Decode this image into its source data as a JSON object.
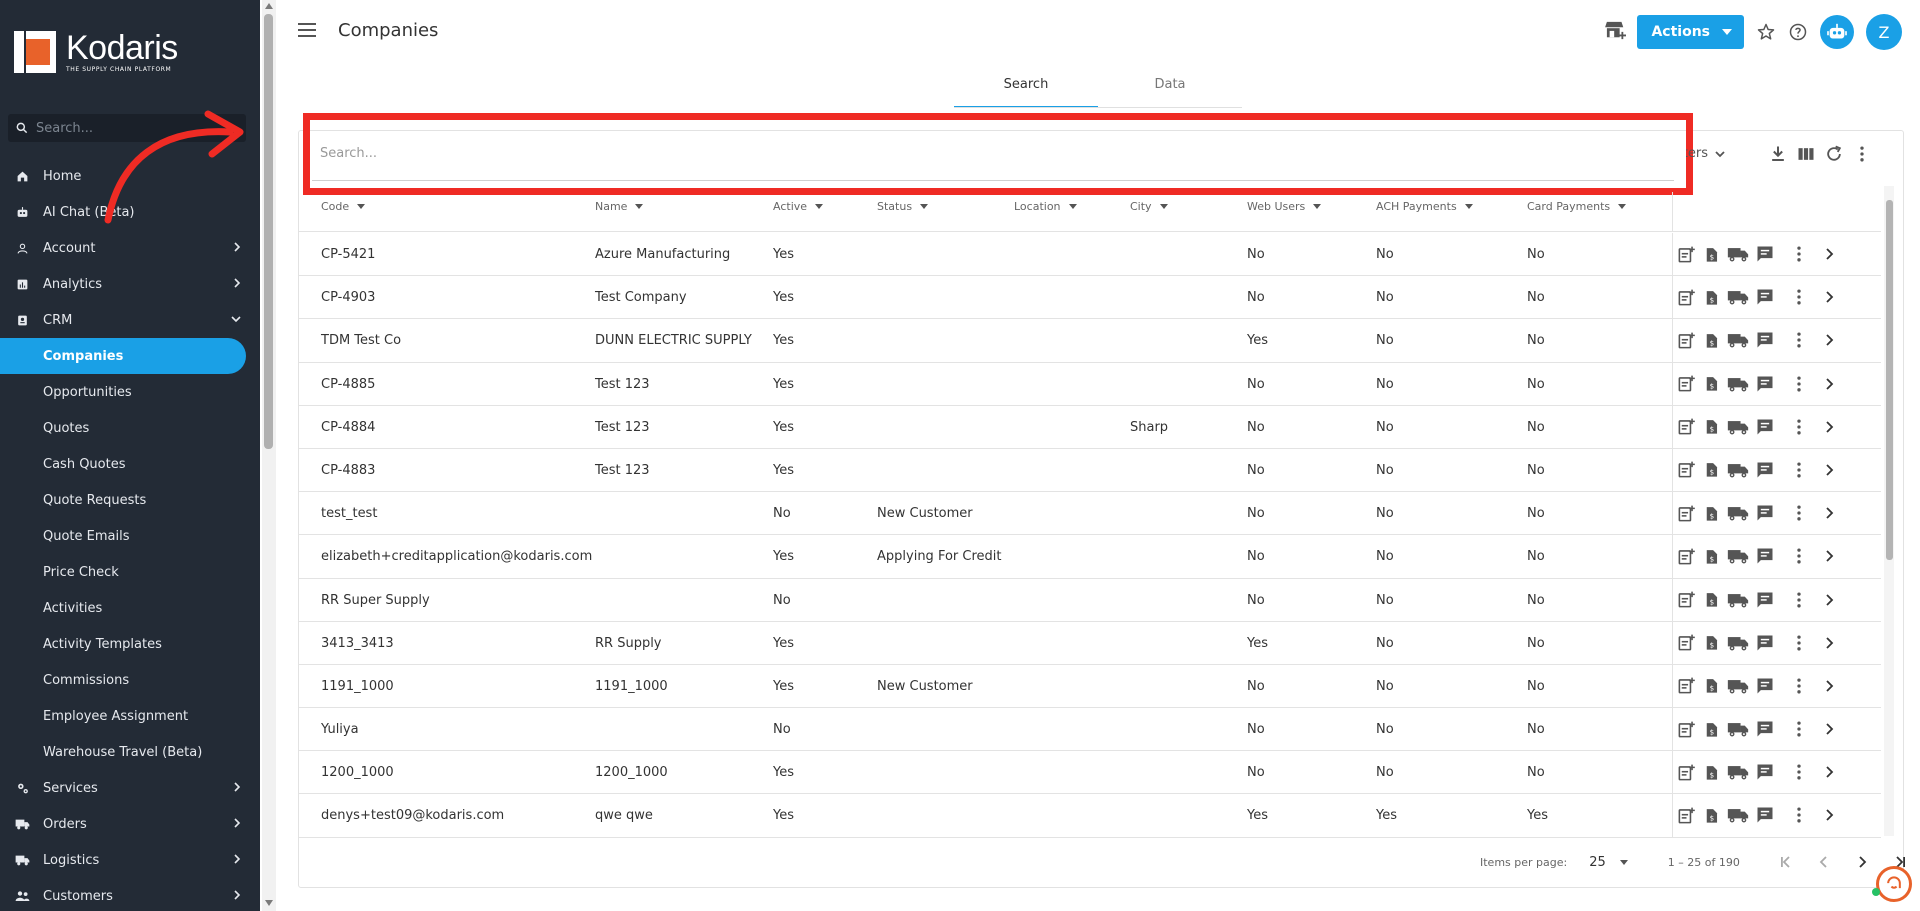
{
  "app": {
    "logo_text": "Kodaris",
    "logo_tagline": "THE SUPPLY CHAIN PLATFORM"
  },
  "sidebar": {
    "search_placeholder": "Search...",
    "items": [
      {
        "label": "Home",
        "icon": "home-icon"
      },
      {
        "label": "AI Chat (Beta)",
        "icon": "robot-icon"
      },
      {
        "label": "Account",
        "icon": "person-icon",
        "expandable": true
      },
      {
        "label": "Analytics",
        "icon": "analytics-icon",
        "expandable": true
      },
      {
        "label": "CRM",
        "icon": "crm-icon",
        "expanded": true
      },
      {
        "label": "Companies",
        "active": true
      },
      {
        "label": "Opportunities"
      },
      {
        "label": "Quotes"
      },
      {
        "label": "Cash Quotes"
      },
      {
        "label": "Quote Requests"
      },
      {
        "label": "Quote Emails"
      },
      {
        "label": "Price Check"
      },
      {
        "label": "Activities"
      },
      {
        "label": "Activity Templates"
      },
      {
        "label": "Commissions"
      },
      {
        "label": "Employee Assignment"
      },
      {
        "label": "Warehouse Travel (Beta)"
      },
      {
        "label": "Services",
        "icon": "gears-icon",
        "expandable": true
      },
      {
        "label": "Orders",
        "icon": "truck-icon",
        "expandable": true
      },
      {
        "label": "Logistics",
        "icon": "truck-icon",
        "expandable": true
      },
      {
        "label": "Customers",
        "icon": "people-icon",
        "expandable": true
      }
    ]
  },
  "header": {
    "title": "Companies",
    "actions_label": "Actions",
    "user_initial": "Z"
  },
  "tabs": [
    "Search",
    "Data"
  ],
  "search": {
    "placeholder": "Search...",
    "filters_label": "Filters"
  },
  "table": {
    "columns": [
      "Code",
      "Name",
      "Active",
      "Status",
      "Location",
      "City",
      "Web Users",
      "ACH Payments",
      "Card Payments"
    ],
    "rows": [
      [
        "CP-5421",
        "Azure Manufacturing",
        "Yes",
        "",
        "",
        "",
        "No",
        "No",
        "No"
      ],
      [
        "CP-4903",
        "Test Company",
        "Yes",
        "",
        "",
        "",
        "No",
        "No",
        "No"
      ],
      [
        "TDM Test Co",
        "DUNN ELECTRIC SUPPLY",
        "Yes",
        "",
        "",
        "",
        "Yes",
        "No",
        "No"
      ],
      [
        "CP-4885",
        "Test 123",
        "Yes",
        "",
        "",
        "",
        "No",
        "No",
        "No"
      ],
      [
        "CP-4884",
        "Test 123",
        "Yes",
        "",
        "",
        "Sharp",
        "No",
        "No",
        "No"
      ],
      [
        "CP-4883",
        "Test 123",
        "Yes",
        "",
        "",
        "",
        "No",
        "No",
        "No"
      ],
      [
        "test_test",
        "",
        "No",
        "New Customer",
        "",
        "",
        "No",
        "No",
        "No"
      ],
      [
        "elizabeth+creditapplication@kodaris.com",
        "",
        "Yes",
        "Applying For Credit",
        "",
        "",
        "No",
        "No",
        "No"
      ],
      [
        "RR Super Supply",
        "",
        "No",
        "",
        "",
        "",
        "No",
        "No",
        "No"
      ],
      [
        "3413_3413",
        "RR Supply",
        "Yes",
        "",
        "",
        "",
        "Yes",
        "No",
        "No"
      ],
      [
        "1191_1000",
        "1191_1000",
        "Yes",
        "New Customer",
        "",
        "",
        "No",
        "No",
        "No"
      ],
      [
        "Yuliya",
        "",
        "No",
        "",
        "",
        "",
        "No",
        "No",
        "No"
      ],
      [
        "1200_1000",
        "1200_1000",
        "Yes",
        "",
        "",
        "",
        "No",
        "No",
        "No"
      ],
      [
        "denys+test09@kodaris.com",
        "qwe qwe",
        "Yes",
        "",
        "",
        "",
        "Yes",
        "Yes",
        "Yes"
      ]
    ]
  },
  "pager": {
    "items_per_page_label": "Items per page:",
    "items_per_page": "25",
    "range": "1 – 25 of 190"
  },
  "colors": {
    "accent": "#1aa0e6",
    "sidebar_bg": "#232b36",
    "highlight": "#ef2b24",
    "brand_orange": "#e8622a"
  }
}
